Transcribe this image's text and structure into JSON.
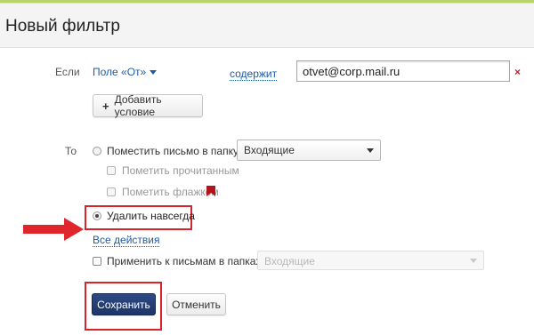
{
  "header": {
    "title": "Новый фильтр"
  },
  "condition": {
    "if_label": "Если",
    "field_label": "Поле «От»",
    "operator_label": "содержит",
    "value": "otvet@corp.mail.ru",
    "remove_label": "×",
    "add_condition_label": "Добавить условие"
  },
  "actions": {
    "to_label": "То",
    "move_to_folder_label": "Поместить письмо в папку",
    "folder_selected": "Входящие",
    "mark_read_label": "Пометить прочитанным",
    "mark_flag_label": "Пометить флажком",
    "delete_forever_label": "Удалить навсегда",
    "all_actions_label": "Все действия",
    "apply_existing_label": "Применить к письмам в папках",
    "apply_folder_selected": "Входящие"
  },
  "footer": {
    "save_label": "Сохранить",
    "cancel_label": "Отменить"
  },
  "colors": {
    "accent_red": "#d9232a",
    "link_blue": "#1f5aa6",
    "save_button": "#1d3567"
  }
}
